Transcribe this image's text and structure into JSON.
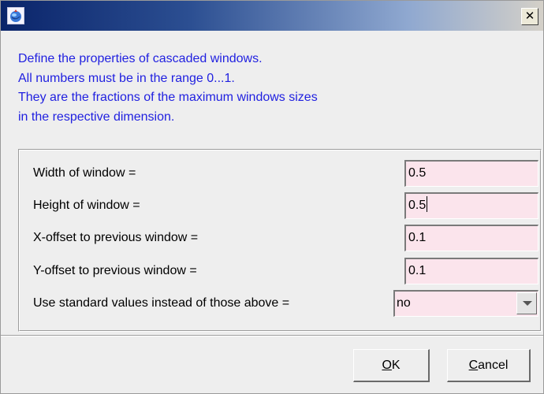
{
  "window": {
    "icon": "app-globe-icon",
    "close_glyph": "✕"
  },
  "info": {
    "lines": [
      "Define the properties of cascaded windows.",
      "All numbers must be in the range 0...1.",
      "They are the fractions of the maximum windows sizes",
      "in the respective dimension."
    ],
    "color": "#1f1fe0"
  },
  "form": {
    "width": {
      "label": "Width of window =",
      "value": "0.5"
    },
    "height": {
      "label": "Height of window =",
      "value": "0.5"
    },
    "x_offset": {
      "label": "X-offset to previous window =",
      "value": "0.1"
    },
    "y_offset": {
      "label": "Y-offset to previous window =",
      "value": "0.1"
    },
    "standard": {
      "label": "Use standard values instead of those above =",
      "value": "no"
    },
    "field_background": "#fbe4ec"
  },
  "buttons": {
    "ok": {
      "mnemonic": "O",
      "rest": "K"
    },
    "cancel": {
      "mnemonic": "C",
      "rest": "ancel"
    }
  }
}
